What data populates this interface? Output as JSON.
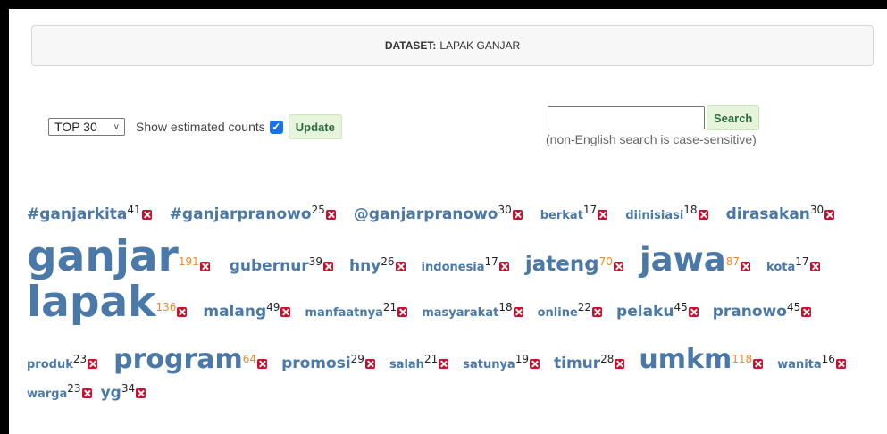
{
  "dataset": {
    "label": "DATASET:",
    "name": "LAPAK GANJAR"
  },
  "controls": {
    "top_select": "TOP 30",
    "estimated_label": "Show estimated counts",
    "update_label": "Update"
  },
  "search": {
    "button_label": "Search",
    "value": "",
    "note": "(non-English search is case-sensitive)"
  },
  "colors": {
    "word": "#4a78a8",
    "count_high": "#f0882a",
    "remove": "#c8102e"
  },
  "cloud": {
    "rows": [
      [
        {
          "word": "#ganjarkita",
          "count": "41"
        },
        {
          "word": "#ganjarpranowo",
          "count": "25"
        },
        {
          "word": "@ganjarpranowo",
          "count": "30"
        },
        {
          "word": "berkat",
          "count": "17"
        },
        {
          "word": "diinisiasi",
          "count": "18"
        },
        {
          "word": "dirasakan",
          "count": "30"
        }
      ],
      [
        {
          "word": "ganjar",
          "count": "191"
        },
        {
          "word": "gubernur",
          "count": "39"
        },
        {
          "word": "hny",
          "count": "26"
        },
        {
          "word": "indonesia",
          "count": "17"
        },
        {
          "word": "jateng",
          "count": "70"
        },
        {
          "word": "jawa",
          "count": "87"
        },
        {
          "word": "kota",
          "count": "17"
        }
      ],
      [
        {
          "word": "lapak",
          "count": "136"
        },
        {
          "word": "malang",
          "count": "49"
        },
        {
          "word": "manfaatnya",
          "count": "21"
        },
        {
          "word": "masyarakat",
          "count": "18"
        },
        {
          "word": "online",
          "count": "22"
        },
        {
          "word": "pelaku",
          "count": "45"
        },
        {
          "word": "pranowo",
          "count": "45"
        }
      ],
      [
        {
          "word": "produk",
          "count": "23"
        },
        {
          "word": "program",
          "count": "64"
        },
        {
          "word": "promosi",
          "count": "29"
        },
        {
          "word": "salah",
          "count": "21"
        },
        {
          "word": "satunya",
          "count": "19"
        },
        {
          "word": "timur",
          "count": "28"
        },
        {
          "word": "umkm",
          "count": "118"
        },
        {
          "word": "wanita",
          "count": "16"
        }
      ],
      [
        {
          "word": "warga",
          "count": "23"
        },
        {
          "word": "yg",
          "count": "34"
        }
      ]
    ]
  }
}
